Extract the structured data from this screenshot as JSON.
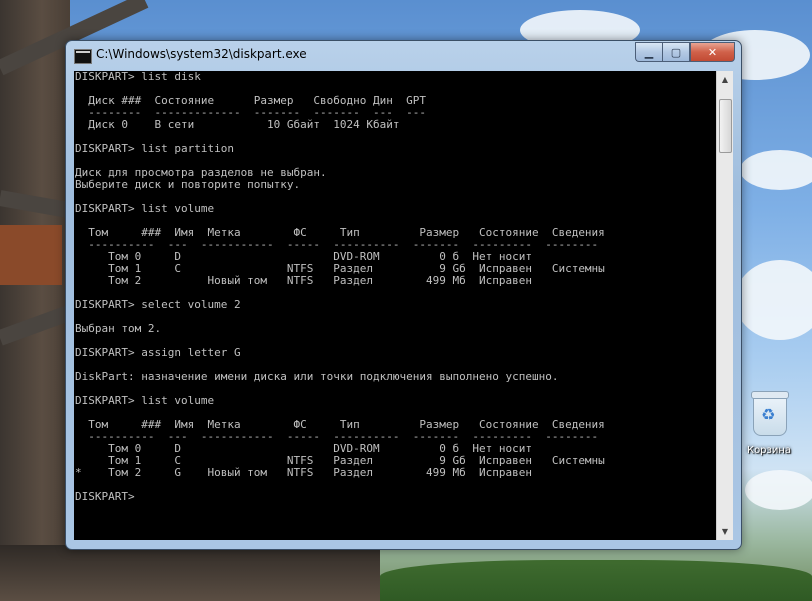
{
  "window": {
    "title": "C:\\Windows\\system32\\diskpart.exe",
    "controls": {
      "minimize": "▁",
      "maximize": "▢",
      "close": "✕"
    }
  },
  "console": {
    "lines": [
      "DISKPART> list disk",
      "",
      "  Диск ###  Состояние      Размер   Свободно Дин  GPT",
      "  --------  -------------  -------  -------  ---  ---",
      "  Диск 0    В сети           10 Gбайт  1024 Kбайт",
      "",
      "DISKPART> list partition",
      "",
      "Диск для просмотра разделов не выбран.",
      "Выберите диск и повторите попытку.",
      "",
      "DISKPART> list volume",
      "",
      "  Том     ###  Имя  Метка        ФС     Тип         Размер   Состояние  Сведения",
      "  ----------  ---  -----------  -----  ----------  -------  ---------  --------",
      "     Том 0     D                       DVD-ROM         0 б  Нет носит",
      "     Том 1     C                NTFS   Раздел          9 Gб  Исправен   Системны",
      "     Том 2          Новый том   NTFS   Раздел        499 Mб  Исправен",
      "",
      "DISKPART> select volume 2",
      "",
      "Выбран том 2.",
      "",
      "DISKPART> assign letter G",
      "",
      "DiskPart: назначение имени диска или точки подключения выполнено успешно.",
      "",
      "DISKPART> list volume",
      "",
      "  Том     ###  Имя  Метка        ФС     Тип         Размер   Состояние  Сведения",
      "  ----------  ---  -----------  -----  ----------  -------  ---------  --------",
      "     Том 0     D                       DVD-ROM         0 б  Нет носит",
      "     Том 1     C                NTFS   Раздел          9 Gб  Исправен   Системны",
      "*    Том 2     G    Новый том   NTFS   Раздел        499 Mб  Исправен",
      "",
      "DISKPART>"
    ]
  },
  "scrollbar": {
    "up_arrow": "▲",
    "down_arrow": "▼"
  },
  "desktop": {
    "recycle_bin_label": "Корзина"
  }
}
